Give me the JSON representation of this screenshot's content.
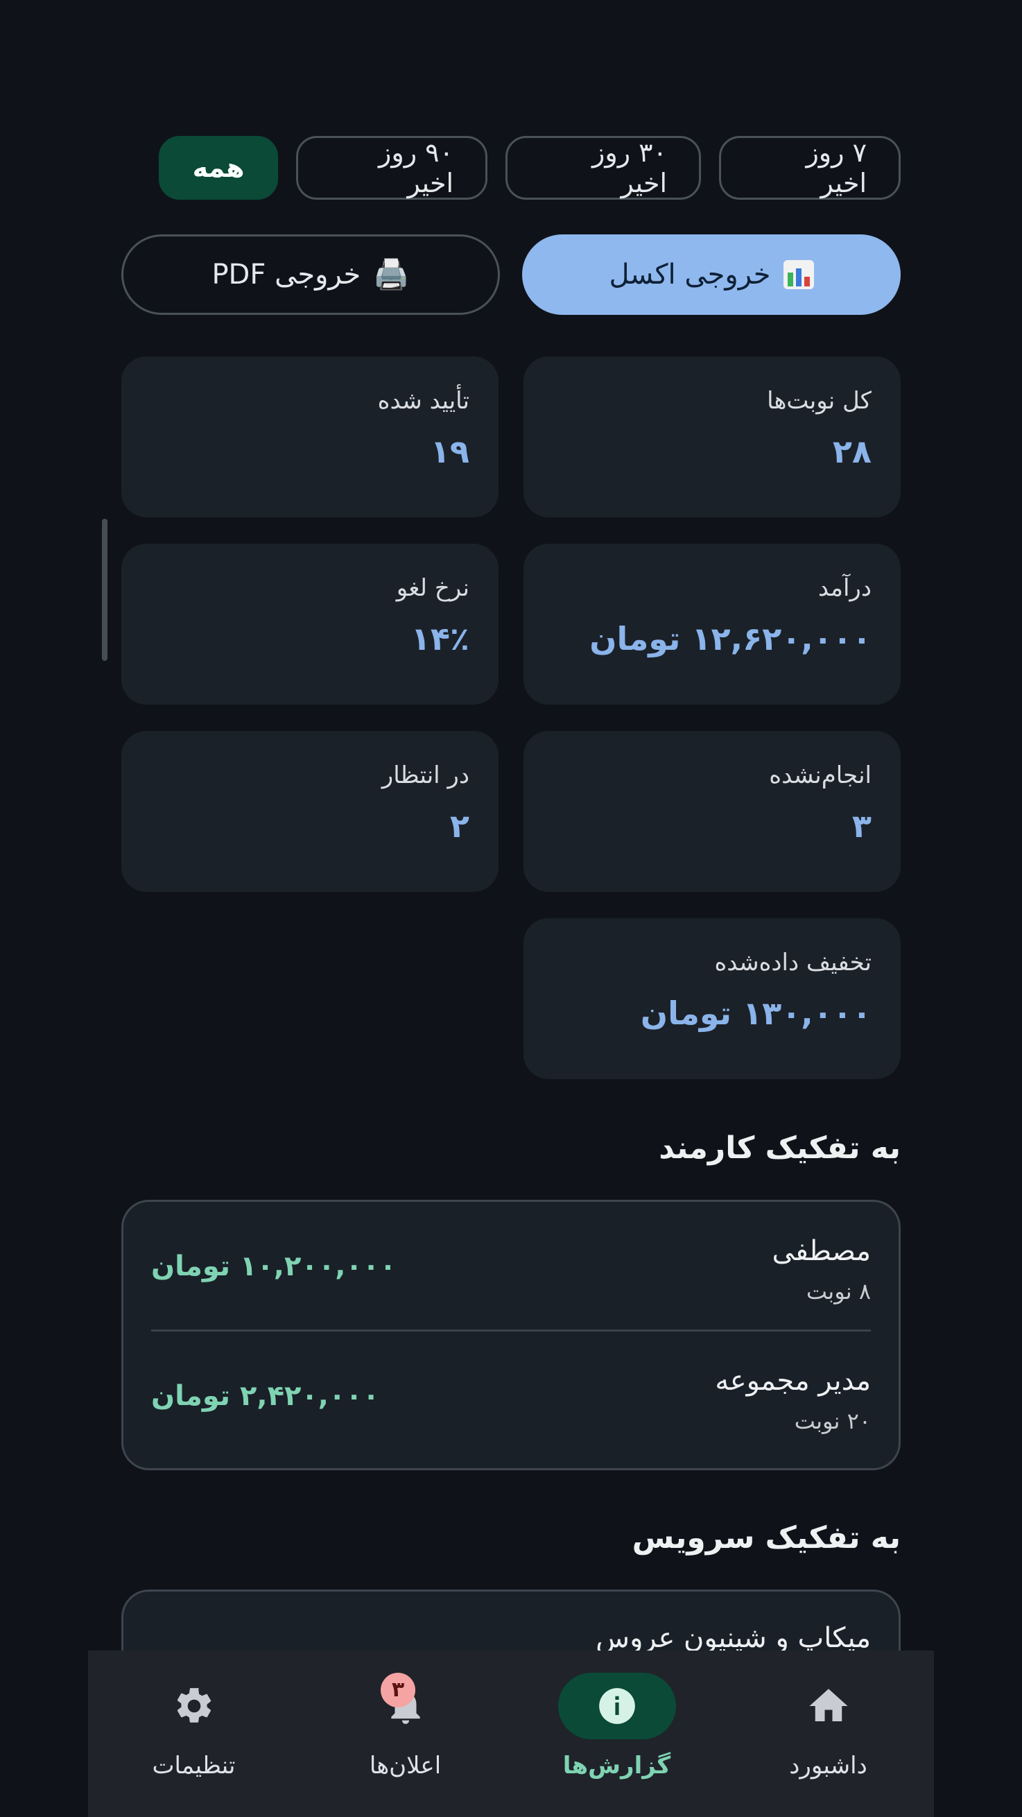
{
  "filters": {
    "last7": "۷ روز اخیر",
    "last30": "۳۰ روز اخیر",
    "last90": "۹۰ روز اخیر",
    "all": "همه"
  },
  "exports": {
    "excel_label": "خروجی اکسل",
    "pdf_label": "خروجی PDF",
    "pdf_icon": "🖨️"
  },
  "stats": {
    "total": {
      "label": "کل نوبت‌ها",
      "value": "۲۸"
    },
    "confirmed": {
      "label": "تأیید شده",
      "value": "۱۹"
    },
    "revenue": {
      "label": "درآمد",
      "value": "۱۲,۶۲۰,۰۰۰ تومان"
    },
    "cancel_rate": {
      "label": "نرخ لغو",
      "value": "۱۴٪"
    },
    "not_done": {
      "label": "انجام‌نشده",
      "value": "۳"
    },
    "pending": {
      "label": "در انتظار",
      "value": "۲"
    },
    "discount": {
      "label": "تخفیف داده‌شده",
      "value": "۱۳۰,۰۰۰ تومان"
    }
  },
  "by_staff": {
    "title": "به تفکیک کارمند",
    "rows": [
      {
        "name": "مصطفی",
        "count": "۸ نوبت",
        "amount": "۱۰,۲۰۰,۰۰۰ تومان"
      },
      {
        "name": "مدیر مجموعه",
        "count": "۲۰ نوبت",
        "amount": "۲,۴۲۰,۰۰۰ تومان"
      }
    ]
  },
  "by_service": {
    "title": "به تفکیک سرویس",
    "rows": [
      {
        "name": "میکاپ و شینیون عروس"
      }
    ]
  },
  "nav": {
    "dashboard": "داشبورد",
    "reports": "گزارش‌ها",
    "notifications": "اعلان‌ها",
    "notifications_badge": "۳",
    "settings": "تنظیمات"
  },
  "colors": {
    "accent_green": "#0a4a37",
    "accent_blue": "#8fb8ee",
    "amount_green": "#7fd3b3"
  }
}
